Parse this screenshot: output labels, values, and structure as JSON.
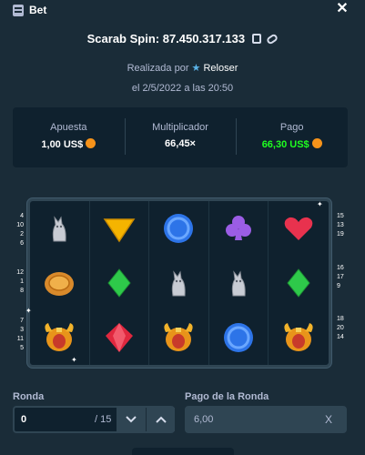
{
  "header": {
    "title": "Bet",
    "icon": "ticket-icon",
    "close_label": "✕"
  },
  "game": {
    "name_line": "Scarab Spin: 87.450.317.133"
  },
  "meta": {
    "by_prefix": "Realizada por",
    "user": "Reloser",
    "date": "el 2/5/2022 a las 20:50"
  },
  "stats": {
    "bet_label": "Apuesta",
    "bet_value": "1,00 US$",
    "mult_label": "Multiplicador",
    "mult_value": "66,45×",
    "payout_label": "Pago",
    "payout_value": "66,30 US$"
  },
  "paylines": {
    "left": [
      "4",
      "10",
      "2",
      "6",
      "12",
      "1",
      "8",
      "7",
      "3",
      "11",
      "5"
    ],
    "right": [
      "15",
      "13",
      "19",
      "16",
      "17",
      "9",
      "18",
      "20",
      "14"
    ]
  },
  "reels": [
    [
      "cat",
      "triangle",
      "blue-circle",
      "club",
      "heart"
    ],
    [
      "coin",
      "diamond",
      "cat",
      "cat",
      "diamond"
    ],
    [
      "scarab",
      "ruby",
      "scarab",
      "blue-circle",
      "scarab"
    ]
  ],
  "round": {
    "label": "Ronda",
    "value": "0",
    "total": "/ 15"
  },
  "round_payout": {
    "label": "Pago de la Ronda",
    "value": "6,00",
    "clear": "X"
  },
  "colors": {
    "bg": "#1a2c38",
    "panel": "#0f212e",
    "win": "#1fff20",
    "accent": "#2f4553"
  }
}
